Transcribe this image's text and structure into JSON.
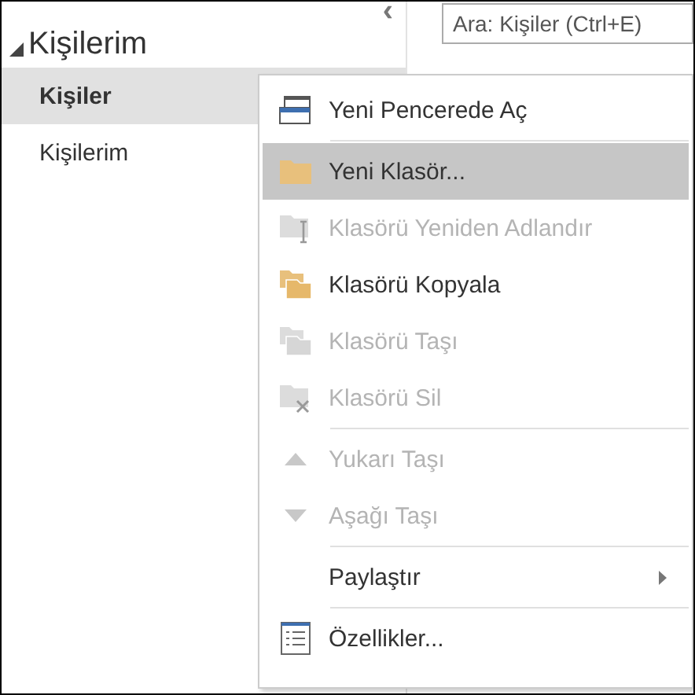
{
  "sidebar": {
    "collapse_glyph": "‹",
    "header": {
      "label": "Kişilerim",
      "expanded": true
    },
    "items": [
      {
        "label": "Kişiler",
        "selected": true
      },
      {
        "label": "Kişilerim",
        "selected": false
      }
    ]
  },
  "search": {
    "placeholder": "Ara: Kişiler (Ctrl+E)"
  },
  "context_menu": {
    "items": [
      {
        "kind": "item",
        "label": "Yeni Pencerede Aç",
        "disabled": false,
        "selected": false,
        "submenu": false
      },
      {
        "kind": "separator"
      },
      {
        "kind": "item",
        "label": "Yeni Klasör...",
        "disabled": false,
        "selected": true,
        "submenu": false
      },
      {
        "kind": "item",
        "label": "Klasörü Yeniden Adlandır",
        "disabled": true,
        "selected": false,
        "submenu": false
      },
      {
        "kind": "item",
        "label": "Klasörü Kopyala",
        "disabled": false,
        "selected": false,
        "submenu": false
      },
      {
        "kind": "item",
        "label": "Klasörü Taşı",
        "disabled": true,
        "selected": false,
        "submenu": false
      },
      {
        "kind": "item",
        "label": "Klasörü Sil",
        "disabled": true,
        "selected": false,
        "submenu": false
      },
      {
        "kind": "separator"
      },
      {
        "kind": "item",
        "label": "Yukarı Taşı",
        "disabled": true,
        "selected": false,
        "submenu": false
      },
      {
        "kind": "item",
        "label": "Aşağı Taşı",
        "disabled": true,
        "selected": false,
        "submenu": false
      },
      {
        "kind": "separator"
      },
      {
        "kind": "item",
        "label": "Paylaştır",
        "disabled": false,
        "selected": false,
        "submenu": true
      },
      {
        "kind": "separator"
      },
      {
        "kind": "item",
        "label": "Özellikler...",
        "disabled": false,
        "selected": false,
        "submenu": false
      }
    ]
  }
}
